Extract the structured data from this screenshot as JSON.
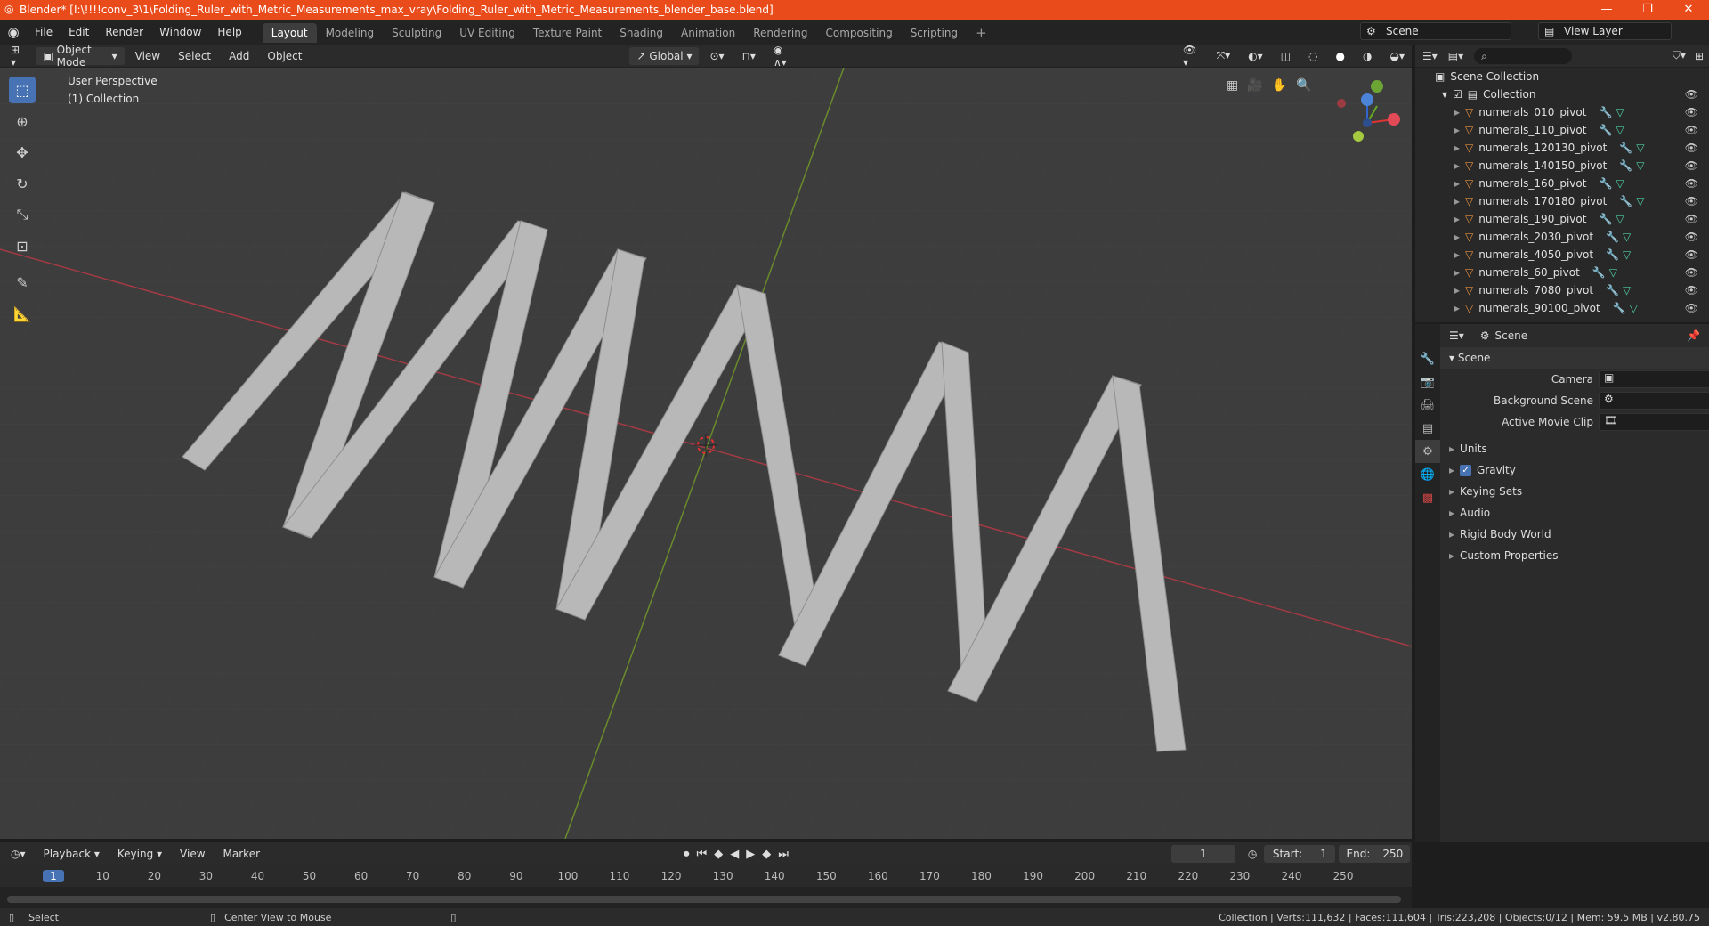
{
  "title": "Blender* [I:\\!!!!conv_3\\1\\Folding_Ruler_with_Metric_Measurements_max_vray\\Folding_Ruler_with_Metric_Measurements_blender_base.blend]",
  "menu": [
    "File",
    "Edit",
    "Render",
    "Window",
    "Help"
  ],
  "workspaces": [
    "Layout",
    "Modeling",
    "Sculpting",
    "UV Editing",
    "Texture Paint",
    "Shading",
    "Animation",
    "Rendering",
    "Compositing",
    "Scripting"
  ],
  "active_workspace": "Layout",
  "scene_name": "Scene",
  "view_layer": "View Layer",
  "viewport_header": {
    "mode": "Object Mode",
    "view": "View",
    "select": "Select",
    "add": "Add",
    "object": "Object",
    "orientation": "Global"
  },
  "viewport": {
    "perspective": "User Perspective",
    "collection": "(1) Collection"
  },
  "outliner": {
    "root": "Scene Collection",
    "collection": "Collection",
    "items": [
      "numerals_010_pivot",
      "numerals_110_pivot",
      "numerals_120130_pivot",
      "numerals_140150_pivot",
      "numerals_160_pivot",
      "numerals_170180_pivot",
      "numerals_190_pivot",
      "numerals_2030_pivot",
      "numerals_4050_pivot",
      "numerals_60_pivot",
      "numerals_7080_pivot",
      "numerals_90100_pivot"
    ]
  },
  "properties": {
    "context": "Scene",
    "panel": "Scene",
    "camera_label": "Camera",
    "background_scene_label": "Background Scene",
    "movie_clip_label": "Active Movie Clip",
    "sections": [
      "Units",
      "Gravity",
      "Keying Sets",
      "Audio",
      "Rigid Body World",
      "Custom Properties"
    ]
  },
  "timeline": {
    "playback": "Playback",
    "keying": "Keying",
    "view": "View",
    "marker": "Marker",
    "current_frame": "1",
    "start_label": "Start:",
    "start": "1",
    "end_label": "End:",
    "end": "250",
    "ticks": [
      "1",
      "10",
      "20",
      "30",
      "40",
      "50",
      "60",
      "70",
      "80",
      "90",
      "100",
      "110",
      "120",
      "130",
      "140",
      "150",
      "160",
      "170",
      "180",
      "190",
      "200",
      "210",
      "220",
      "230",
      "240",
      "250"
    ]
  },
  "status": {
    "select": "Select",
    "center": "Center View to Mouse",
    "stats": "Collection | Verts:111,632 | Faces:111,604 | Tris:223,208 | Objects:0/12 | Mem: 59.5 MB | v2.80.75"
  }
}
